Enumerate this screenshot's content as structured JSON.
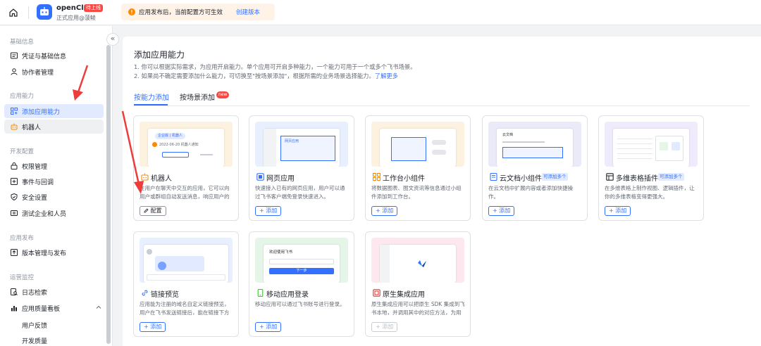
{
  "topbar": {
    "app_name": "openClaw",
    "app_tag": "待上线",
    "app_subtitle": "正式应用@菠鲮",
    "notice_text": "应用发布后，当前配置方可生效",
    "notice_link": "创建版本"
  },
  "sidebar": {
    "sections": [
      {
        "title": "基础信息",
        "items": [
          "凭证与基础信息",
          "协作者管理"
        ]
      },
      {
        "title": "应用能力",
        "items": [
          "添加应用能力",
          "机器人"
        ]
      },
      {
        "title": "开发配置",
        "items": [
          "权限管理",
          "事件与回调",
          "安全设置",
          "测试企业和人员"
        ]
      },
      {
        "title": "应用发布",
        "items": [
          "版本管理与发布"
        ]
      },
      {
        "title": "运营监控",
        "items": [
          "日志检索",
          "应用质量看板"
        ]
      }
    ],
    "sub_items": [
      "用户反馈",
      "开发质量"
    ],
    "collapse_glyph": "«",
    "chevron_glyph": "^"
  },
  "main": {
    "title": "添加应用能力",
    "desc1": "1. 你可以根据实际需求，为应用开启能力。单个应用可开启多种能力，一个能力可用于一个或多个飞书场景。",
    "desc2": "2. 如果尚不确定需要添加什么能力，可切换至\"按场景添加\"，根据所需的业务场景选择能力。",
    "desc2_link": "了解更多",
    "tabs": [
      "按能力添加",
      "按场景添加"
    ],
    "tab_badge": "new",
    "cards": [
      {
        "title": "机器人",
        "desc": "在用户在聊天中交互的应用，它可以向用户或群组自动发送消息，响应用户的消...",
        "button": "配置",
        "icon": "robot-icon",
        "preview_bg": "#fdf1e0"
      },
      {
        "title": "网页应用",
        "desc": "快速接入已有的网页应用，用户可以通过飞书客户端免登录快速进入。",
        "button": "+ 添加",
        "icon": "web-app-icon",
        "preview_bg": "#e8efff"
      },
      {
        "title": "工作台小组件",
        "desc": "将数据图表、图文资讯等信息通过小组件添加到工作台。",
        "button": "+ 添加",
        "icon": "widget-icon",
        "preview_bg": "#fdf1e0"
      },
      {
        "title": "云文档小组件",
        "tag": "可添加多个",
        "desc": "在云文档中扩展内容或者添加快捷操作。",
        "button": "+ 添加",
        "icon": "doc-widget-icon",
        "preview_bg": "#eaeaf8"
      },
      {
        "title": "多维表格插件",
        "tag": "可添加多个",
        "desc": "在多维表格上制作视图、逻辑插件，让你的多维表格变得更强大。",
        "button": "+ 添加",
        "icon": "table-plugin-icon",
        "preview_bg": "#efeafc"
      },
      {
        "title": "链接预览",
        "desc": "应用能为注册的域名自定义链接预览，用户在飞书发送链接后，能在链接下方展示...",
        "button": "+ 添加",
        "icon": "link-icon",
        "preview_bg": "#e8efff"
      },
      {
        "title": "移动应用登录",
        "desc": "移动应用可以通过飞书账号进行登录。",
        "button": "+ 添加",
        "icon": "mobile-login-icon",
        "preview_bg": "#e5f6e8"
      },
      {
        "title": "原生集成应用",
        "desc": "原生集成应用可以把原生 SDK 集成到飞书本地，并调用其中的对应方法，为用户提...",
        "button": "+ 添加",
        "icon": "native-app-icon",
        "preview_bg": "#fde8f0"
      }
    ],
    "preview_texts": {
      "robot_chip": "企业版 | 机器人",
      "robot_date": "2022-06-20 机器人通知",
      "web_header": "网页应用",
      "mobile_header": "欢迎使用飞书",
      "mobile_btn": "下一步",
      "doc_header": "云文档"
    }
  }
}
